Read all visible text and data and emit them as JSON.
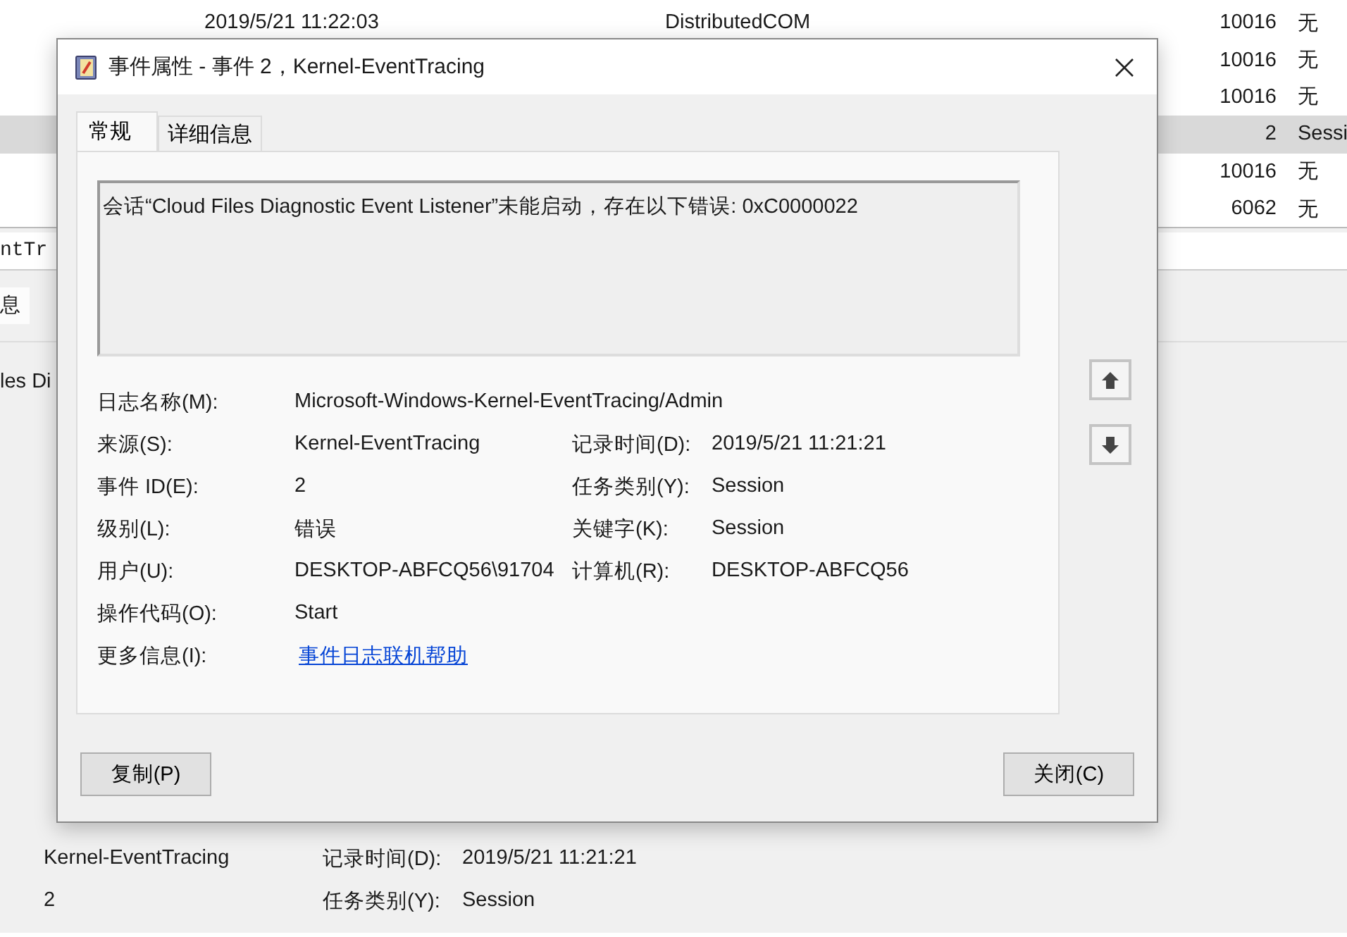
{
  "background": {
    "list_rows": [
      {
        "date": "2019/5/21 11:22:03",
        "source": "DistributedCOM",
        "event_id": "10016",
        "category": "无",
        "selected": false
      },
      {
        "date": "",
        "source": "",
        "event_id": "10016",
        "category": "无",
        "selected": false
      },
      {
        "date": "",
        "source": "",
        "event_id": "10016",
        "category": "无",
        "selected": false
      },
      {
        "date": "",
        "source": "",
        "event_id": "2",
        "category": "Sessi",
        "selected": true
      },
      {
        "date": "",
        "source": "",
        "event_id": "10016",
        "category": "无",
        "selected": false
      },
      {
        "date": "",
        "source": "",
        "event_id": "6062",
        "category": "无",
        "selected": false
      }
    ],
    "preview_title": "ntTr",
    "preview_tab": "息",
    "preview_message": "les Di",
    "preview_fields": [
      {
        "value": "Kernel-EventTracing",
        "label": "记录时间(D):",
        "value_2": "2019/5/21 11:21:21"
      },
      {
        "value": "2",
        "label": "任务类别(Y):",
        "value_2": "Session"
      }
    ]
  },
  "dialog": {
    "title": "事件属性 - 事件 2，Kernel-EventTracing",
    "tabs": [
      {
        "label": "常规",
        "selected": true
      },
      {
        "label": "详细信息",
        "selected": false
      }
    ],
    "message": "会话“Cloud Files Diagnostic Event Listener”未能启动，存在以下错误: 0xC0000022",
    "fields": [
      {
        "label": "日志名称(M):",
        "value": "Microsoft-Windows-Kernel-EventTracing/Admin",
        "kind": "text"
      },
      {
        "label": "来源(S):",
        "value": "Kernel-EventTracing",
        "label_2": "记录时间(D):",
        "value_2": "2019/5/21 11:21:21",
        "kind": "text"
      },
      {
        "label": "事件 ID(E):",
        "value": "2",
        "label_2": "任务类别(Y):",
        "value_2": "Session",
        "kind": "text"
      },
      {
        "label": "级别(L):",
        "value": "错误",
        "label_2": "关键字(K):",
        "value_2": "Session",
        "kind": "text"
      },
      {
        "label": "用户(U):",
        "value": "DESKTOP-ABFCQ56\\91704",
        "label_2": "计算机(R):",
        "value_2": "DESKTOP-ABFCQ56",
        "kind": "text"
      },
      {
        "label": "操作代码(O):",
        "value": "Start",
        "kind": "text"
      },
      {
        "label": "更多信息(I):",
        "value": "事件日志联机帮助",
        "kind": "link"
      }
    ],
    "buttons": [
      {
        "label": "复制(P)"
      },
      {
        "label": "关闭(C)"
      }
    ]
  }
}
